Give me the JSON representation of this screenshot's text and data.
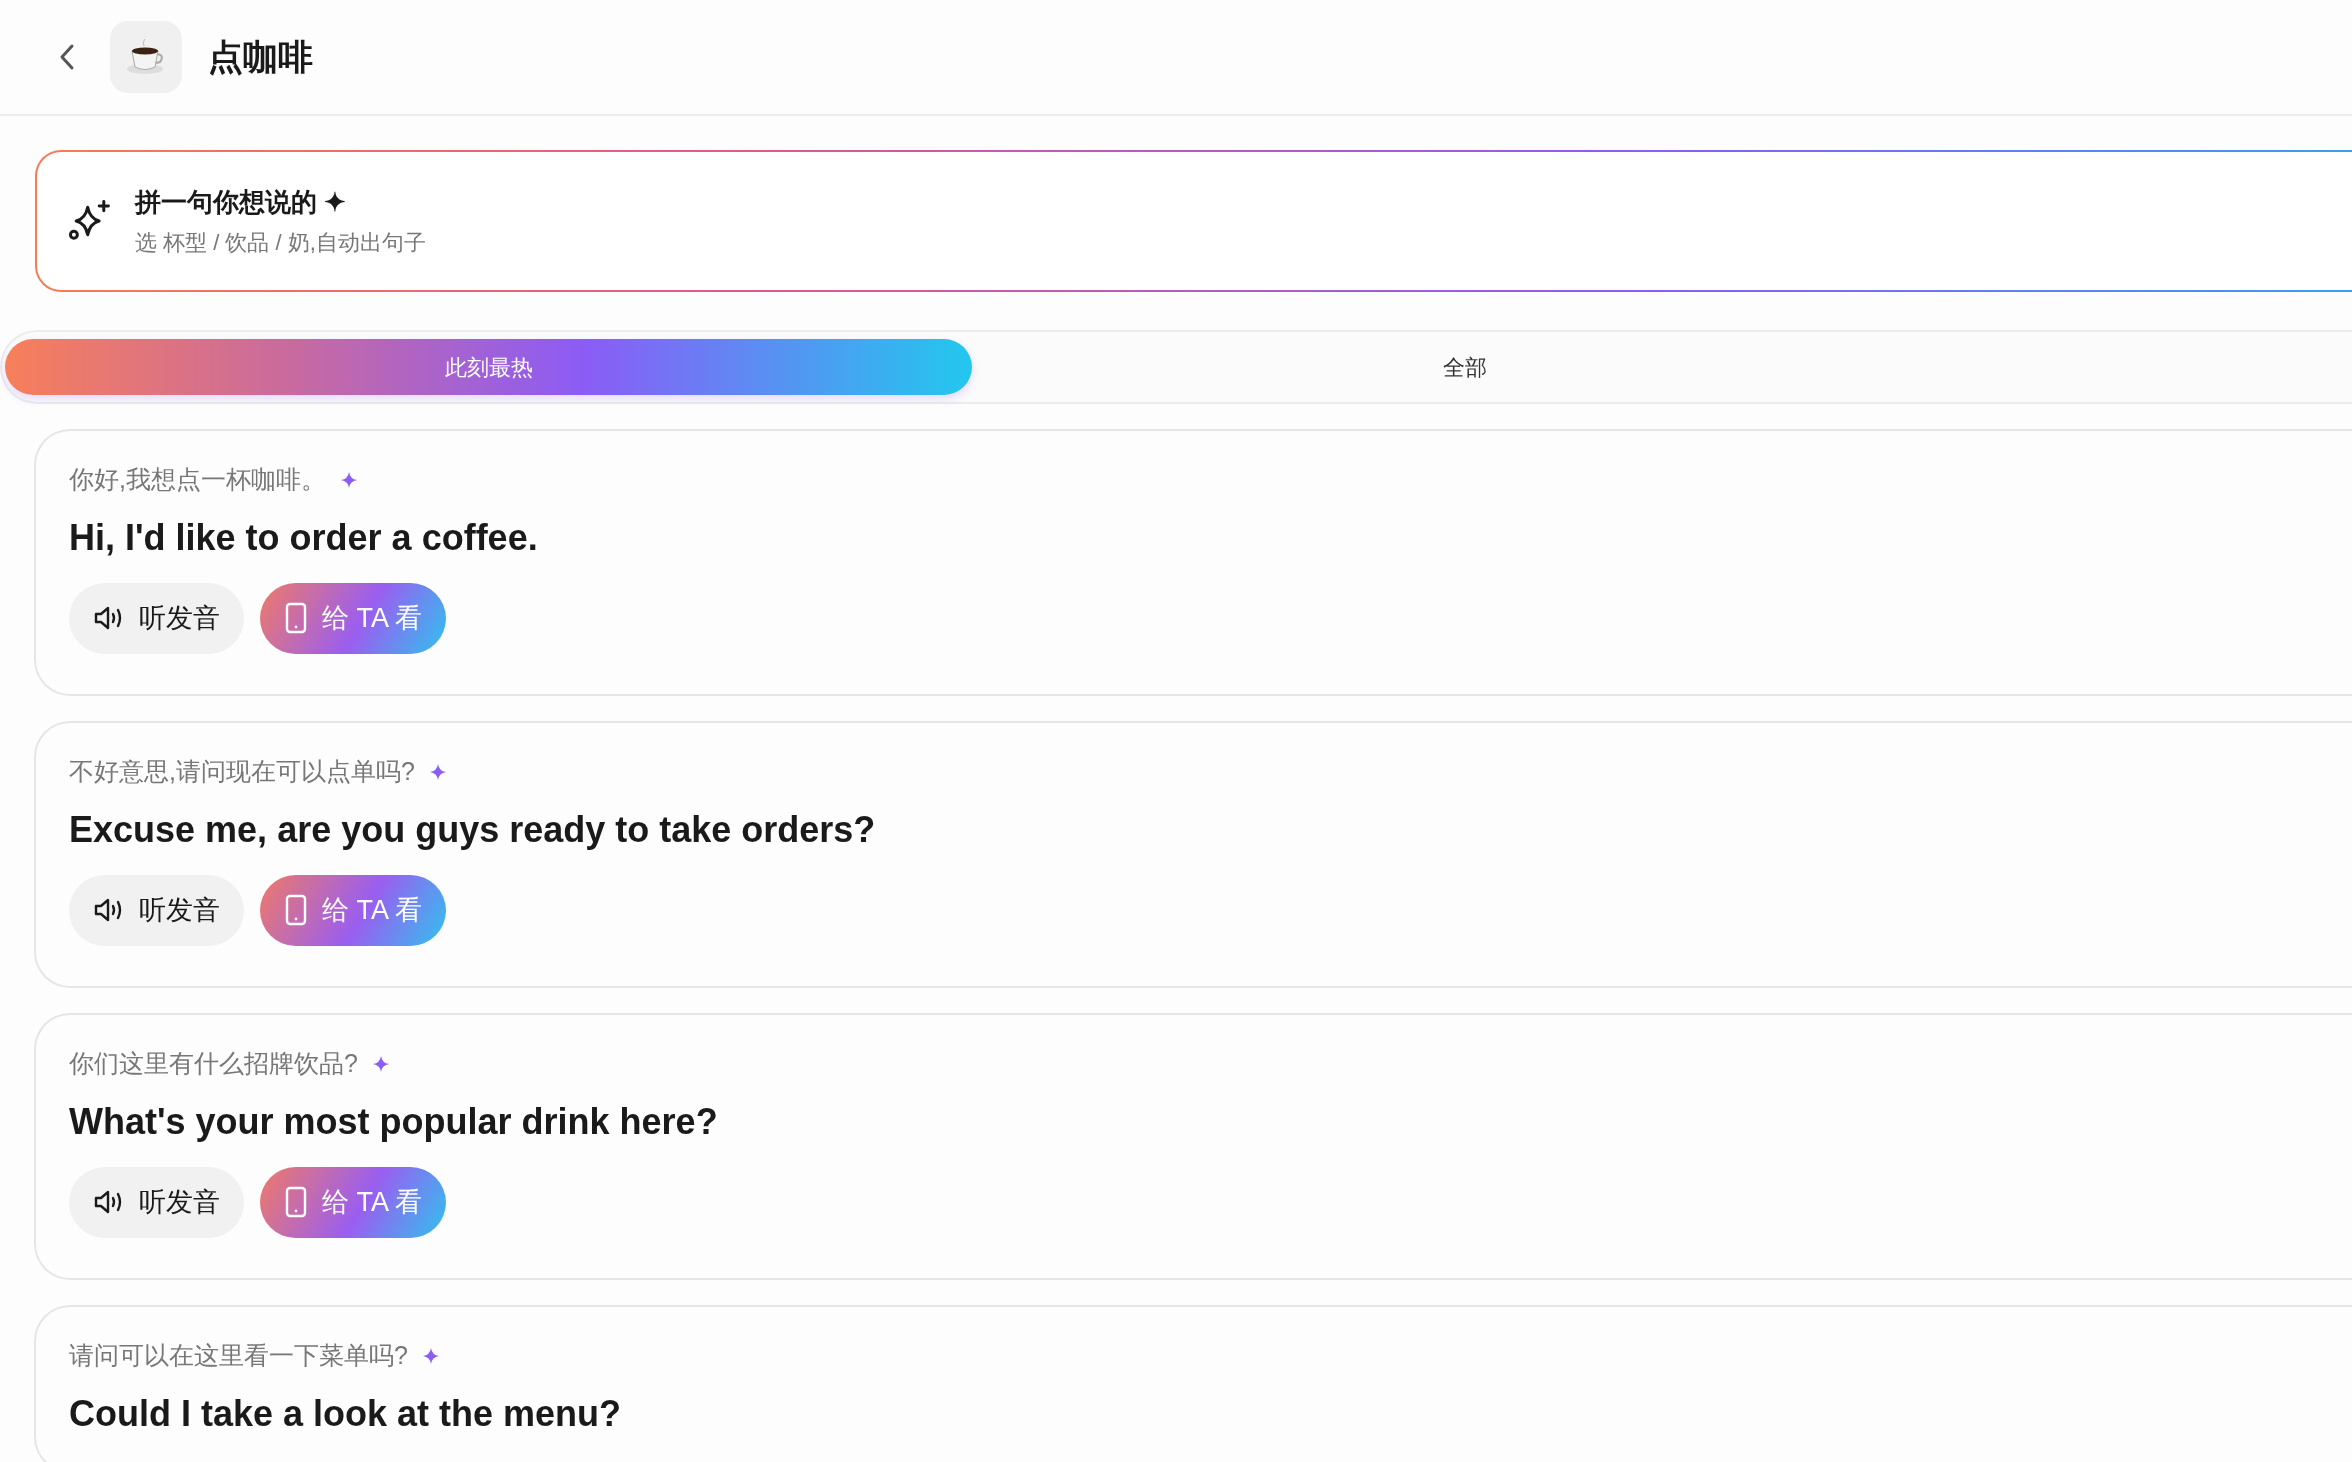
{
  "header": {
    "title": "点咖啡"
  },
  "composer": {
    "title": "拼一句你想说的 ✦",
    "subtitle": "选 杯型 / 饮品 / 奶,自动出句子"
  },
  "tabs": [
    {
      "label": "此刻最热",
      "selected": true
    },
    {
      "label": "全部",
      "selected": false
    }
  ],
  "phrases": [
    {
      "chinese": "你好,我想点一杯咖啡。",
      "english": "Hi, I'd like to order a coffee.",
      "buttons": [
        {
          "kind": "listen",
          "label": "听发音"
        },
        {
          "kind": "show",
          "label": "给 TA 看"
        }
      ]
    },
    {
      "chinese": "不好意思,请问现在可以点单吗?",
      "english": "Excuse me, are you guys ready to take orders?",
      "buttons": [
        {
          "kind": "listen",
          "label": "听发音"
        },
        {
          "kind": "show",
          "label": "给 TA 看"
        }
      ]
    },
    {
      "chinese": "你们这里有什么招牌饮品?",
      "english": "What's your most popular drink here?",
      "buttons": [
        {
          "kind": "listen",
          "label": "听发音"
        },
        {
          "kind": "show",
          "label": "给 TA 看"
        }
      ]
    },
    {
      "chinese": "请问可以在这里看一下菜单吗?",
      "english": "Could I take a look at the menu?"
    }
  ]
}
